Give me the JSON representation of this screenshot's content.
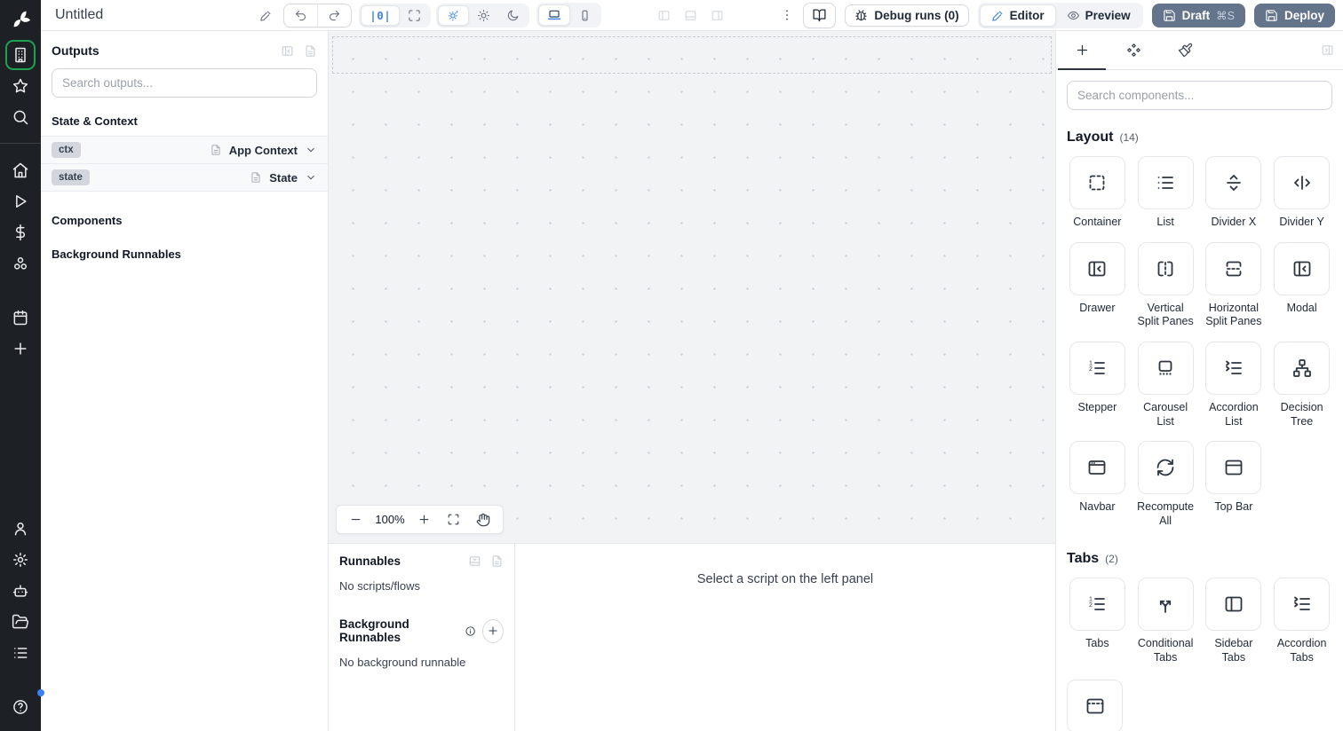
{
  "topbar": {
    "title": "Untitled",
    "zoom_toggle_label": "|0|",
    "debug_runs_label": "Debug runs (0)",
    "editor_label": "Editor",
    "preview_label": "Preview",
    "draft_label": "Draft",
    "draft_shortcut": "⌘S",
    "deploy_label": "Deploy"
  },
  "rail": {
    "groups": [
      {
        "divider_after": true,
        "items": [
          {
            "name": "apps",
            "icon": "building",
            "active": true
          },
          {
            "name": "favorites",
            "icon": "star"
          },
          {
            "name": "search",
            "icon": "search"
          }
        ]
      },
      {
        "items": [
          {
            "name": "home",
            "icon": "home"
          },
          {
            "name": "runs",
            "icon": "play"
          },
          {
            "name": "variables",
            "icon": "dollar"
          },
          {
            "name": "resources",
            "icon": "circles"
          }
        ]
      },
      {
        "gap_before": true,
        "items": [
          {
            "name": "schedules",
            "icon": "calendar"
          },
          {
            "name": "add",
            "icon": "plus"
          }
        ]
      }
    ],
    "bottom_items": [
      {
        "name": "user",
        "icon": "user"
      },
      {
        "name": "settings",
        "icon": "gear"
      },
      {
        "name": "workers",
        "icon": "bot"
      },
      {
        "name": "folders",
        "icon": "folder"
      },
      {
        "name": "audit-logs",
        "icon": "rows"
      }
    ]
  },
  "outputs_panel": {
    "title": "Outputs",
    "search_placeholder": "Search outputs...",
    "state_context_label": "State & Context",
    "components_label": "Components",
    "background_runnables_label": "Background Runnables",
    "rows": [
      {
        "badge": "ctx",
        "type": "App Context"
      },
      {
        "badge": "state",
        "type": "State"
      }
    ]
  },
  "canvas": {
    "zoom_level": "100%"
  },
  "runnables_panel": {
    "title": "Runnables",
    "empty_scripts": "No scripts/flows",
    "background_title": "Background Runnables",
    "empty_background": "No background runnable"
  },
  "script_placeholder": "Select a script on the left panel",
  "components_panel": {
    "search_placeholder": "Search components...",
    "sections": [
      {
        "title": "Layout",
        "count_label": "(14)",
        "items": [
          {
            "label": "Container",
            "icon": "container"
          },
          {
            "label": "List",
            "icon": "list"
          },
          {
            "label": "Divider X",
            "icon": "sep-h"
          },
          {
            "label": "Divider Y",
            "icon": "sep-v"
          },
          {
            "label": "Drawer",
            "icon": "panel-left-close"
          },
          {
            "label": "Vertical Split Panes",
            "icon": "split-v"
          },
          {
            "label": "Horizontal Split Panes",
            "icon": "split-h"
          },
          {
            "label": "Modal",
            "icon": "panel-left-close"
          },
          {
            "label": "Stepper",
            "icon": "list-ordered"
          },
          {
            "label": "Carousel List",
            "icon": "carousel"
          },
          {
            "label": "Accordion List",
            "icon": "list-chevrons"
          },
          {
            "label": "Decision Tree",
            "icon": "tree"
          },
          {
            "label": "Navbar",
            "icon": "app-window"
          },
          {
            "label": "Recompute All",
            "icon": "refresh"
          },
          {
            "label": "Top Bar",
            "icon": "panel-top"
          }
        ]
      },
      {
        "title": "Tabs",
        "count_label": "(2)",
        "items": [
          {
            "label": "Tabs",
            "icon": "list-ordered"
          },
          {
            "label": "Conditional Tabs",
            "icon": "split-arrows"
          },
          {
            "label": "Sidebar Tabs",
            "icon": "panel-left"
          },
          {
            "label": "Accordion Tabs",
            "icon": "list-chevrons"
          }
        ]
      }
    ],
    "partial_item": {
      "icon": "panel-top-dashed"
    }
  },
  "colors": {
    "accent": "#3b82f6",
    "active_green": "#1ea150",
    "slate_button": "#64748b"
  }
}
